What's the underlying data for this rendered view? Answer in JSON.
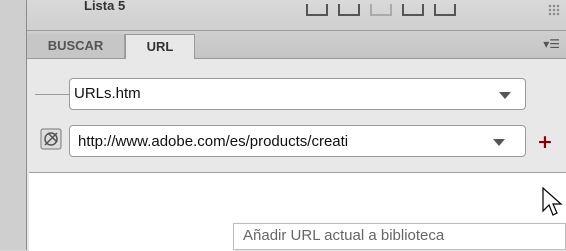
{
  "top_strip": {
    "partial_title": "Lista 5"
  },
  "panel": {
    "tabs": [
      {
        "label": "BUSCAR",
        "active": false
      },
      {
        "label": "URL",
        "active": true
      }
    ],
    "file_select": {
      "value": "URLs.htm"
    },
    "url_select": {
      "value": "http://www.adobe.com/es/products/creati"
    },
    "add_button": {
      "label": "+"
    },
    "tooltip": {
      "text": "Añadir URL actual a biblioteca"
    }
  },
  "icons": {
    "panel_menu": "panel-menu-icon",
    "url_prefix": "globe-url-icon",
    "cursor": "arrow-cursor-icon"
  },
  "colors": {
    "add_button": "#8b0000",
    "panel_bg": "#e8e8e8",
    "tab_bar_bg": "#c9c9c9"
  }
}
